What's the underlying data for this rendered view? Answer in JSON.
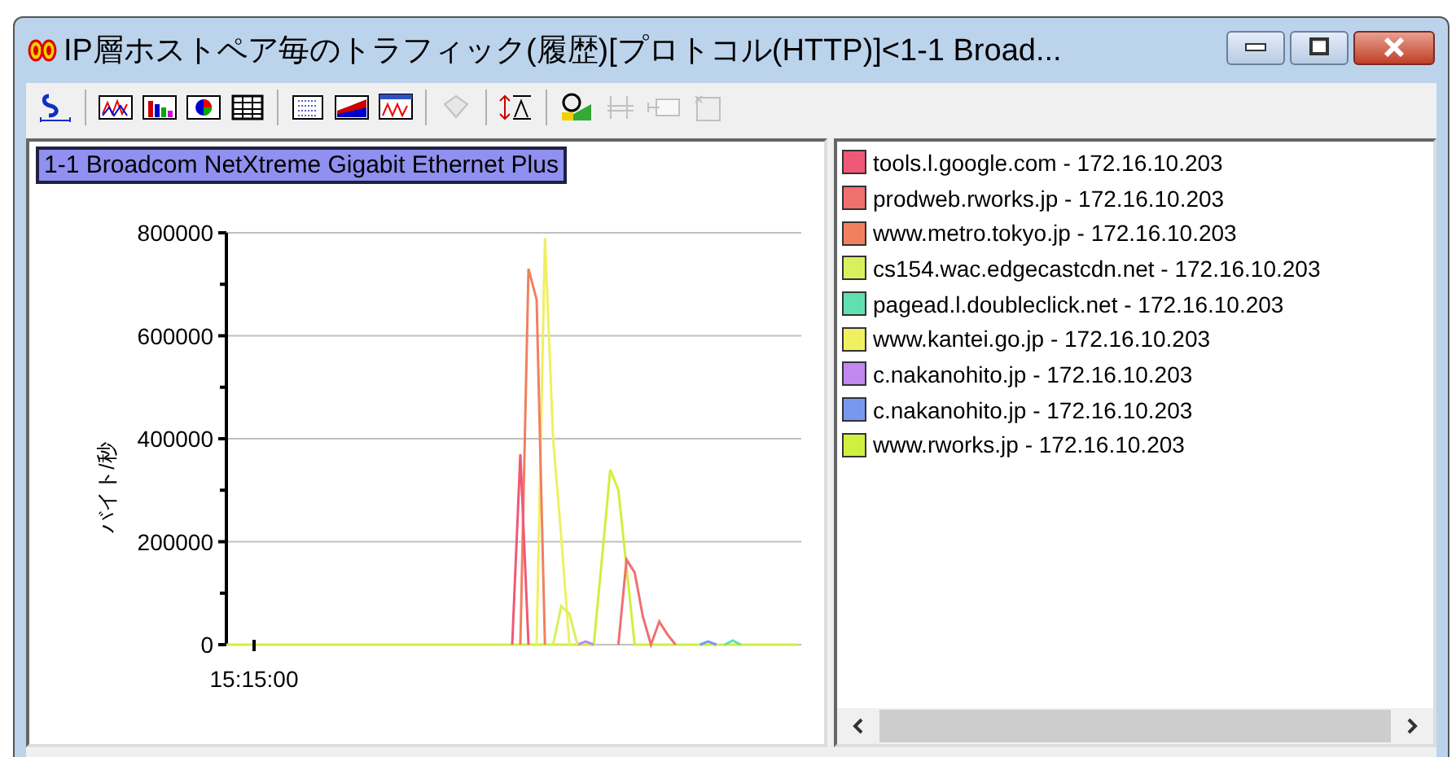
{
  "window": {
    "title": "IP層ホストペア毎のトラフィック(履歴)[プロトコル(HTTP)]<1-1 Broad..."
  },
  "toolbar": [
    {
      "kind": "scale",
      "disabled": false
    },
    {
      "kind": "sep"
    },
    {
      "kind": "line",
      "disabled": false
    },
    {
      "kind": "bar",
      "disabled": false
    },
    {
      "kind": "pie",
      "disabled": false
    },
    {
      "kind": "table",
      "disabled": false
    },
    {
      "kind": "sep"
    },
    {
      "kind": "list",
      "disabled": false
    },
    {
      "kind": "area",
      "disabled": false
    },
    {
      "kind": "window",
      "disabled": false
    },
    {
      "kind": "sep"
    },
    {
      "kind": "diamond",
      "disabled": true
    },
    {
      "kind": "sep"
    },
    {
      "kind": "sort",
      "disabled": false
    },
    {
      "kind": "sep"
    },
    {
      "kind": "zoom",
      "disabled": false
    },
    {
      "kind": "grid",
      "disabled": true
    },
    {
      "kind": "columns",
      "disabled": true
    },
    {
      "kind": "note",
      "disabled": true
    }
  ],
  "chart": {
    "heading": "1-1 Broadcom NetXtreme Gigabit Ethernet Plus",
    "time_label": "15:15:00",
    "chart_data": {
      "type": "line",
      "ylabel": "バイト/秒",
      "grid": true,
      "ylim": [
        0,
        800000
      ],
      "yticks": [
        0,
        200000,
        400000,
        600000,
        800000
      ],
      "series": [
        {
          "name": "tools.l.google.com - 172.16.10.203",
          "color": "#f05878",
          "values": [
            null,
            null,
            null,
            null,
            null,
            null,
            null,
            null,
            null,
            null,
            null,
            null,
            null,
            null,
            null,
            null,
            null,
            null,
            null,
            null,
            null,
            null,
            null,
            null,
            null,
            null,
            null,
            null,
            null,
            null,
            null,
            null,
            null,
            null,
            null,
            0,
            370000,
            0,
            null,
            null,
            null,
            null,
            null,
            null,
            null,
            null,
            null,
            null,
            null,
            null,
            null,
            null,
            null,
            null,
            null,
            null,
            null,
            null,
            null,
            null,
            null,
            null,
            null,
            null,
            null,
            null,
            null,
            null,
            null,
            null,
            null
          ]
        },
        {
          "name": "prodweb.rworks.jp - 172.16.10.203",
          "color": "#f07070",
          "values": [
            null,
            null,
            null,
            null,
            null,
            null,
            null,
            null,
            null,
            null,
            null,
            null,
            null,
            null,
            null,
            null,
            null,
            null,
            null,
            null,
            null,
            null,
            null,
            null,
            null,
            null,
            null,
            null,
            null,
            null,
            null,
            null,
            null,
            null,
            null,
            null,
            null,
            null,
            null,
            null,
            null,
            null,
            null,
            null,
            null,
            null,
            null,
            null,
            0,
            165000,
            140000,
            55000,
            0,
            45000,
            20000,
            0,
            null,
            null,
            null,
            null,
            null,
            null,
            null,
            null,
            null,
            null,
            null,
            null,
            null,
            null,
            null
          ]
        },
        {
          "name": "www.metro.tokyo.jp - 172.16.10.203",
          "color": "#f08060",
          "values": [
            null,
            null,
            null,
            null,
            null,
            null,
            null,
            null,
            null,
            null,
            null,
            null,
            null,
            null,
            null,
            null,
            null,
            null,
            null,
            null,
            null,
            null,
            null,
            null,
            null,
            null,
            null,
            null,
            null,
            null,
            null,
            null,
            null,
            null,
            null,
            null,
            0,
            730000,
            670000,
            0,
            null,
            null,
            null,
            null,
            null,
            null,
            null,
            null,
            null,
            null,
            null,
            null,
            null,
            null,
            null,
            null,
            null,
            null,
            null,
            null,
            null,
            null,
            null,
            null,
            null,
            null,
            null,
            null,
            null,
            null,
            null
          ]
        },
        {
          "name": "cs154.wac.edgecastcdn.net - 172.16.10.203",
          "color": "#d8f060",
          "values": [
            null,
            null,
            null,
            null,
            null,
            null,
            null,
            null,
            null,
            null,
            null,
            null,
            null,
            null,
            null,
            null,
            null,
            null,
            null,
            null,
            null,
            null,
            null,
            null,
            null,
            null,
            null,
            null,
            null,
            null,
            null,
            null,
            null,
            null,
            null,
            null,
            null,
            null,
            null,
            null,
            0,
            75000,
            60000,
            0,
            null,
            null,
            null,
            null,
            null,
            null,
            null,
            null,
            null,
            null,
            null,
            null,
            null,
            null,
            null,
            null,
            null,
            null,
            null,
            null,
            null,
            null,
            null,
            null,
            null,
            null,
            null
          ]
        },
        {
          "name": "pagead.l.doubleclick.net - 172.16.10.203",
          "color": "#60e0b0",
          "values": [
            null,
            null,
            null,
            null,
            null,
            null,
            null,
            null,
            null,
            null,
            null,
            null,
            null,
            null,
            null,
            null,
            null,
            null,
            null,
            null,
            null,
            null,
            null,
            null,
            null,
            null,
            null,
            null,
            null,
            null,
            null,
            null,
            null,
            null,
            null,
            null,
            null,
            null,
            null,
            null,
            null,
            null,
            null,
            null,
            null,
            null,
            null,
            null,
            null,
            null,
            null,
            null,
            null,
            null,
            null,
            null,
            null,
            null,
            null,
            null,
            null,
            0,
            8000,
            0,
            null,
            null,
            null,
            null,
            null,
            null,
            null
          ]
        },
        {
          "name": "www.kantei.go.jp - 172.16.10.203",
          "color": "#f0f060",
          "values": [
            null,
            null,
            null,
            null,
            null,
            null,
            null,
            null,
            null,
            null,
            null,
            null,
            null,
            null,
            null,
            null,
            null,
            null,
            null,
            null,
            null,
            null,
            null,
            null,
            null,
            null,
            null,
            null,
            null,
            null,
            null,
            null,
            null,
            null,
            null,
            null,
            null,
            null,
            0,
            790000,
            400000,
            210000,
            0,
            null,
            null,
            null,
            null,
            null,
            null,
            null,
            null,
            null,
            null,
            null,
            null,
            null,
            null,
            null,
            null,
            null,
            null,
            null,
            null,
            null,
            null,
            null,
            null,
            null,
            null,
            null,
            null
          ]
        },
        {
          "name": "c.nakanohito.jp - 172.16.10.203",
          "color": "#c088f0",
          "values": [
            null,
            null,
            null,
            null,
            null,
            null,
            null,
            null,
            null,
            null,
            null,
            null,
            null,
            null,
            null,
            null,
            null,
            null,
            null,
            null,
            null,
            null,
            null,
            null,
            null,
            null,
            null,
            null,
            null,
            null,
            null,
            null,
            null,
            null,
            null,
            null,
            null,
            null,
            null,
            null,
            null,
            null,
            null,
            0,
            6000,
            0,
            null,
            null,
            null,
            null,
            null,
            null,
            null,
            null,
            null,
            null,
            null,
            null,
            null,
            null,
            null,
            null,
            null,
            null,
            null,
            null,
            null,
            null,
            null,
            null,
            null
          ]
        },
        {
          "name": "c.nakanohito.jp - 172.16.10.203",
          "color": "#7898f0",
          "values": [
            null,
            null,
            null,
            null,
            null,
            null,
            null,
            null,
            null,
            null,
            null,
            null,
            null,
            null,
            null,
            null,
            null,
            null,
            null,
            null,
            null,
            null,
            null,
            null,
            null,
            null,
            null,
            null,
            null,
            null,
            null,
            null,
            null,
            null,
            null,
            null,
            null,
            null,
            null,
            null,
            null,
            null,
            null,
            null,
            null,
            null,
            null,
            null,
            null,
            null,
            null,
            null,
            null,
            null,
            null,
            null,
            null,
            null,
            0,
            6000,
            0,
            null,
            null,
            null,
            null,
            null,
            null,
            null,
            null,
            null,
            null
          ]
        },
        {
          "name": "www.rworks.jp - 172.16.10.203",
          "color": "#d0f040",
          "values": [
            0,
            0,
            0,
            0,
            0,
            0,
            0,
            0,
            0,
            0,
            0,
            0,
            0,
            0,
            0,
            0,
            0,
            0,
            0,
            0,
            0,
            0,
            0,
            0,
            0,
            0,
            0,
            0,
            0,
            0,
            0,
            0,
            0,
            0,
            0,
            0,
            0,
            0,
            0,
            0,
            0,
            0,
            0,
            0,
            0,
            0,
            170000,
            340000,
            300000,
            150000,
            0,
            0,
            0,
            0,
            0,
            0,
            0,
            0,
            0,
            0,
            0,
            0,
            0,
            0,
            0,
            0,
            0,
            0,
            0,
            0,
            0
          ]
        }
      ]
    }
  }
}
